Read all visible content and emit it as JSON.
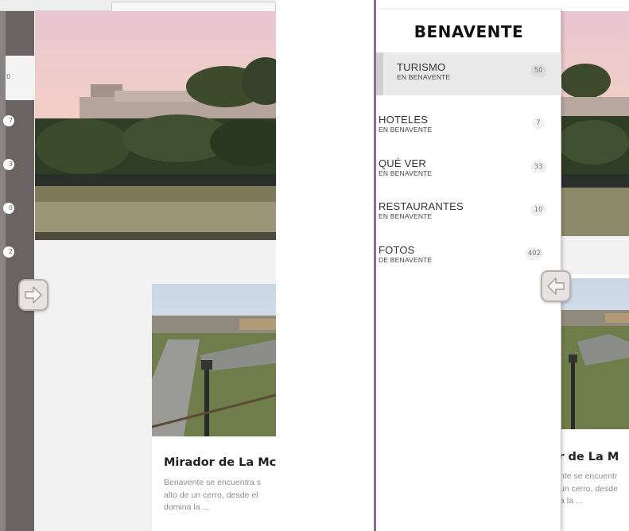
{
  "left_screen": {
    "rail_counts": [
      "0",
      "7",
      "3",
      "0",
      "2"
    ],
    "card": {
      "title": "Mirador de La Mc",
      "description": "Benavente se encuentra s\nalto de un cerro, desde el\ndomina la ..."
    },
    "next_button_icon": "arrow-right-icon"
  },
  "right_screen": {
    "drawer": {
      "title": "BENAVENTE",
      "items": [
        {
          "label": "TURISMO",
          "sub": "EN BENAVENTE",
          "count": "50"
        },
        {
          "label": "HOTELES",
          "sub": "EN BENAVENTE",
          "count": "7"
        },
        {
          "label": "QUÉ VER",
          "sub": "EN BENAVENTE",
          "count": "33"
        },
        {
          "label": "RESTAURANTES",
          "sub": "EN BENAVENTE",
          "count": "10"
        },
        {
          "label": "FOTOS",
          "sub": "DE BENAVENTE",
          "count": "402"
        }
      ]
    },
    "card": {
      "title": "dor de La M",
      "description": "nte se encuentr\nun cerro, desde\na la ..."
    },
    "back_button_icon": "arrow-left-icon"
  },
  "colors": {
    "rail": "#6a6364",
    "active_item": "#e9e9e9",
    "frame_accent": "#8a6f8a"
  }
}
